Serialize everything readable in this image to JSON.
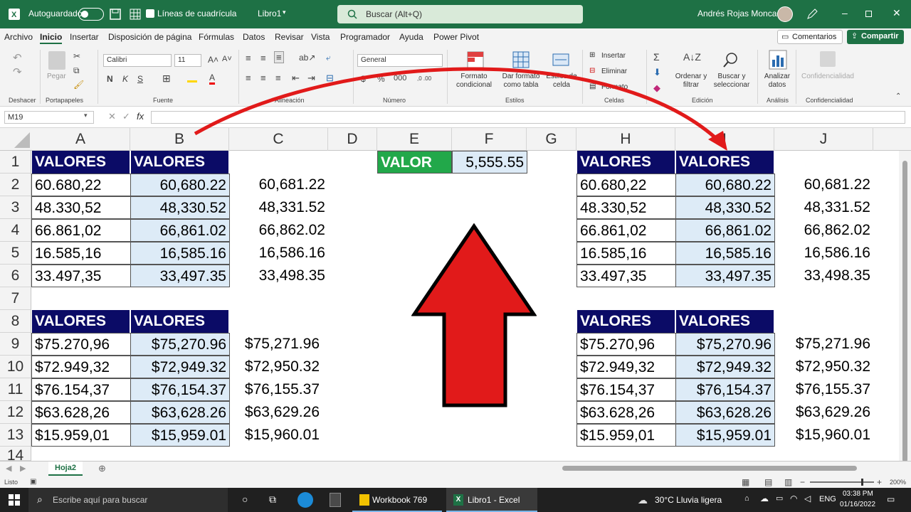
{
  "titlebar": {
    "autosave_label": "Autoguardado",
    "gridlines_label": "Líneas de cuadrícula",
    "workbook_name": "Libro1",
    "search_placeholder": "Buscar (Alt+Q)",
    "user_name": "Andrés Rojas Moncada"
  },
  "menu": {
    "items": [
      "Archivo",
      "Inicio",
      "Insertar",
      "Disposición de página",
      "Fórmulas",
      "Datos",
      "Revisar",
      "Vista",
      "Programador",
      "Ayuda",
      "Power Pivot"
    ],
    "active": "Inicio",
    "comments_label": "Comentarios",
    "share_label": "Compartir"
  },
  "ribbon": {
    "undo_group": "Deshacer",
    "paste_label": "Pegar",
    "clipboard_group": "Portapapeles",
    "font_name": "Calibri",
    "font_size": "11",
    "font_group": "Fuente",
    "alignment_group": "Alineación",
    "number_format": "General",
    "number_group": "Número",
    "cond_format_label": "Formato condicional",
    "table_format_label": "Dar formato como tabla",
    "cell_styles_label": "Estilos de celda",
    "styles_group": "Estilos",
    "insert_label": "Insertar",
    "delete_label": "Eliminar",
    "format_label": "Formato",
    "cells_group": "Celdas",
    "sort_label": "Ordenar y filtrar",
    "find_label": "Buscar y seleccionar",
    "edit_group": "Edición",
    "analyze_label": "Analizar datos",
    "analysis_group": "Análisis",
    "confidential_label": "Confidencialidad",
    "confidential_group": "Confidencialidad"
  },
  "formula_bar": {
    "name_box": "M19",
    "fx": "fx",
    "formula": ""
  },
  "columns": [
    "A",
    "B",
    "C",
    "D",
    "E",
    "F",
    "G",
    "H",
    "I",
    "J"
  ],
  "rows": [
    "1",
    "2",
    "3",
    "4",
    "5",
    "6",
    "7",
    "8",
    "9",
    "10",
    "11",
    "12",
    "13",
    "14"
  ],
  "cells": {
    "A1": "VALORES",
    "B1": "VALORES",
    "E1": "VALOR",
    "F1": "5,555.55",
    "A2": "60.680,22",
    "B2": "60,680.22",
    "C2": "60,681.22",
    "A3": "48.330,52",
    "B3": "48,330.52",
    "C3": "48,331.52",
    "A4": "66.861,02",
    "B4": "66,861.02",
    "C4": "66,862.02",
    "A5": "16.585,16",
    "B5": "16,585.16",
    "C5": "16,586.16",
    "A6": "33.497,35",
    "B6": "33,497.35",
    "C6": "33,498.35",
    "A8": "VALORES",
    "B8": "VALORES",
    "A9": "$75.270,96",
    "B9": "$75,270.96",
    "C9": "$75,271.96",
    "A10": "$72.949,32",
    "B10": "$72,949.32",
    "C10": "$72,950.32",
    "A11": "$76.154,37",
    "B11": "$76,154.37",
    "C11": "$76,155.37",
    "A12": "$63.628,26",
    "B12": "$63,628.26",
    "C12": "$63,629.26",
    "A13": "$15.959,01",
    "B13": "$15,959.01",
    "C13": "$15,960.01",
    "H1": "VALORES",
    "I1": "VALORES",
    "H2": "60.680,22",
    "I2": "60,680.22",
    "J2": "60,681.22",
    "H3": "48.330,52",
    "I3": "48,330.52",
    "J3": "48,331.52",
    "H4": "66.861,02",
    "I4": "66,861.02",
    "J4": "66,862.02",
    "H5": "16.585,16",
    "I5": "16,585.16",
    "J5": "16,586.16",
    "H6": "33.497,35",
    "I6": "33,497.35",
    "J6": "33,498.35",
    "H8": "VALORES",
    "I8": "VALORES",
    "H9": "$75.270,96",
    "I9": "$75,270.96",
    "J9": "$75,271.96",
    "H10": "$72.949,32",
    "I10": "$72,949.32",
    "J10": "$72,950.32",
    "H11": "$76.154,37",
    "I11": "$76,154.37",
    "J11": "$76,155.37",
    "H12": "$63.628,26",
    "I12": "$63,628.26",
    "J12": "$63,629.26",
    "H13": "$15.959,01",
    "I13": "$15,959.01",
    "J13": "$15,960.01"
  },
  "sheet_tabs": [
    "Hoja2"
  ],
  "status": {
    "ready": "Listo",
    "zoom": "200%"
  },
  "taskbar": {
    "search_placeholder": "Escribe aquí para buscar",
    "app1": "Workbook 769",
    "app2": "Libro1 - Excel",
    "weather": "30°C  Lluvia ligera",
    "lang": "ENG",
    "time": "03:38 PM",
    "date": "01/16/2022"
  },
  "colors": {
    "excel_green": "#1e7145",
    "header_navy": "#0b0b66",
    "light_blue": "#ddebf7",
    "value_green": "#22a84a",
    "arrow_red": "#e11a1a"
  }
}
